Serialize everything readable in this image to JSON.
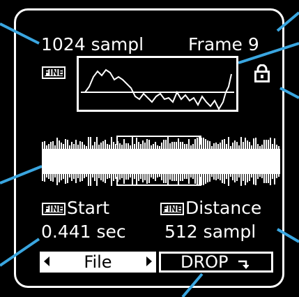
{
  "header": {
    "samples": "1024 sampl",
    "frame": "Frame 9"
  },
  "overview": {
    "fine_badge": "FINE"
  },
  "lock": {
    "icon": "lock-icon"
  },
  "labels": {
    "start_badge": "FINE",
    "start": "Start",
    "distance_badge": "FINE",
    "distance": "Distance"
  },
  "values": {
    "start": "0.441 sec",
    "distance": "512 sampl"
  },
  "footer": {
    "file": "File",
    "drop": "DROP"
  },
  "colors": {
    "background": "#000000",
    "foreground": "#ffffff"
  }
}
